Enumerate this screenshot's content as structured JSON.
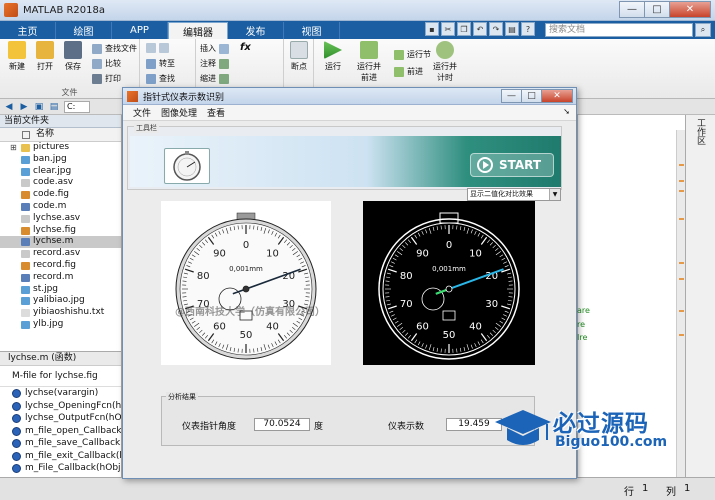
{
  "window": {
    "title": "MATLAB R2018a",
    "minimize": "—",
    "maximize": "□",
    "close": "✕"
  },
  "tabs": [
    "主页",
    "绘图",
    "APP",
    "编辑器",
    "发布",
    "视图"
  ],
  "search": {
    "placeholder": "搜索文档"
  },
  "toolbar": {
    "file_group": "文件",
    "new": "新建",
    "open": "打开",
    "save": "保存",
    "find_files": "查找文件",
    "compare": "比较",
    "print": "打印",
    "goto": "转至",
    "find": "查找",
    "insert": "插入",
    "comment": "注释",
    "indent": "缩进",
    "fx": "fx",
    "breakpoint": "断点",
    "run": "运行",
    "run_advance": "运行并\n前进",
    "run_section": "运行节",
    "advance": "前进",
    "run_time": "运行并\n计时"
  },
  "address": {
    "path": "C:"
  },
  "current_folder": {
    "header": "当前文件夹",
    "name_col": "名称",
    "items": [
      {
        "name": "pictures",
        "type": "folder"
      },
      {
        "name": "ban.jpg",
        "type": "jpg"
      },
      {
        "name": "clear.jpg",
        "type": "jpg"
      },
      {
        "name": "code.asv",
        "type": "asv"
      },
      {
        "name": "code.fig",
        "type": "fig"
      },
      {
        "name": "code.m",
        "type": "m"
      },
      {
        "name": "lychse.asv",
        "type": "asv"
      },
      {
        "name": "lychse.fig",
        "type": "fig"
      },
      {
        "name": "lychse.m",
        "type": "m",
        "selected": true
      },
      {
        "name": "record.asv",
        "type": "asv"
      },
      {
        "name": "record.fig",
        "type": "fig"
      },
      {
        "name": "record.m",
        "type": "m"
      },
      {
        "name": "st.jpg",
        "type": "jpg"
      },
      {
        "name": "yalibiao.jpg",
        "type": "jpg"
      },
      {
        "name": "yibiaoshishu.txt",
        "type": "txt"
      },
      {
        "name": "ylb.jpg",
        "type": "jpg"
      }
    ]
  },
  "details": {
    "header": "lychse.m  (函数)",
    "description": "M-file for lychse.fig",
    "functions": [
      "lychse(varargin)",
      "lychse_OpeningFcn(hObj",
      "lychse_OutputFcn(hObje",
      "m_file_open_Callback(hO",
      "m_file_save_Callback(hO",
      "m_file_exit_Callback(hOb",
      "m_File_Callback(hObject,"
    ]
  },
  "right_code": [
    "are",
    "re",
    "Ire"
  ],
  "workspace_label": "工作区",
  "status": {
    "row_label": "行",
    "row": "1",
    "col_label": "列",
    "col": "1"
  },
  "gui": {
    "title": "指针式仪表示数识别",
    "menus": [
      "文件",
      "图像处理",
      "查看"
    ],
    "toolbar_label": "工具栏",
    "start_label": "START",
    "display_mode": "显示二值化对比效果",
    "watermark": "@西南科技大学（仿真有限公司）",
    "gauge_dial_labels": [
      "10",
      "20",
      "30",
      "40",
      "50",
      "60",
      "70",
      "80",
      "90",
      "0"
    ],
    "gauge_unit": "0,001mm",
    "results": {
      "title": "分析结果",
      "angle_label": "仪表指针角度",
      "angle_value": "70.0524",
      "angle_unit": "度",
      "reading_label": "仪表示数",
      "reading_value": "19.459"
    }
  },
  "brand": {
    "cn": "必过源码",
    "en": "Biguo100.com"
  },
  "colors": {
    "accent": "#1b5ea2",
    "brand": "#1c64b7",
    "needle": "#2ab7e8"
  }
}
